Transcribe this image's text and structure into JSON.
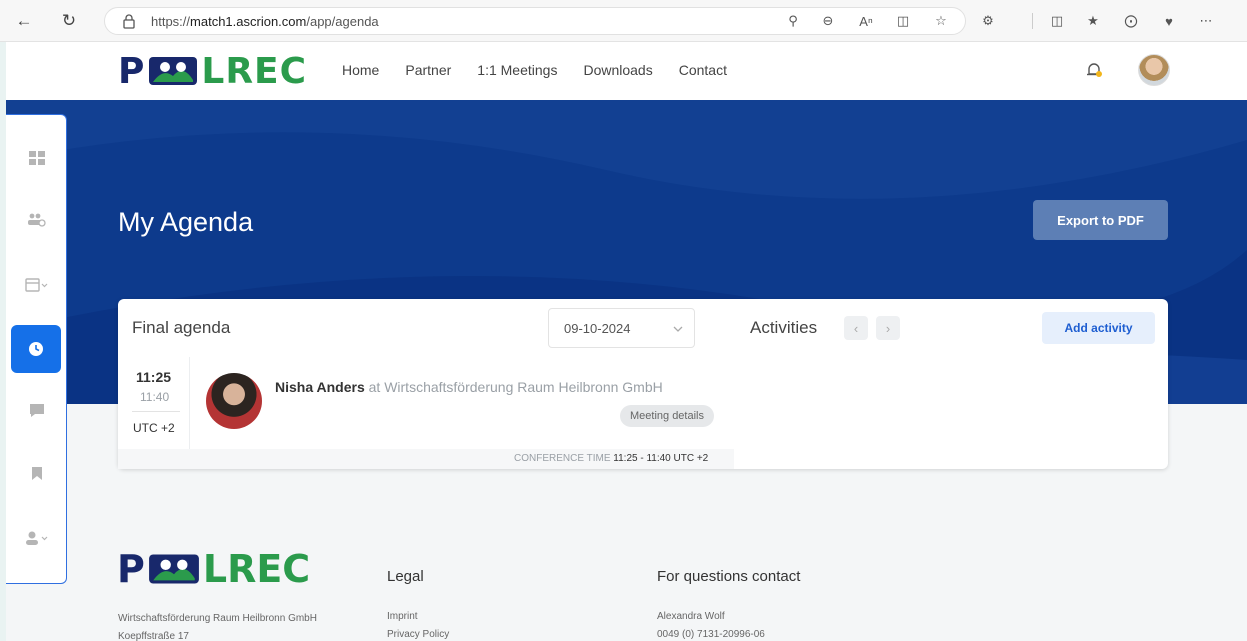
{
  "browser": {
    "url_prefix": "https://",
    "url_host": "match1.ascrion.com",
    "url_path": "/app/agenda"
  },
  "header": {
    "logo_left": "P",
    "logo_right": "LREC",
    "nav": [
      "Home",
      "Partner",
      "1:1 Meetings",
      "Downloads",
      "Contact"
    ]
  },
  "hero": {
    "title": "My Agenda",
    "export_label": "Export to PDF"
  },
  "agenda": {
    "title": "Final agenda",
    "date": "09-10-2024",
    "activities_title": "Activities",
    "add_activity_label": "Add activity",
    "meeting": {
      "start": "11:25",
      "end": "11:40",
      "timezone": "UTC +2",
      "name": "Nisha Anders",
      "org": "at Wirtschaftsförderung Raum Heilbronn GmbH",
      "details_label": "Meeting details",
      "conf_time_label": "CONFERENCE TIME",
      "conf_time_value": "11:25 - 11:40 UTC +2"
    }
  },
  "footer": {
    "logo_left": "P",
    "logo_right": "LREC",
    "company": "Wirtschaftsförderung Raum Heilbronn GmbH",
    "street": "Koepffstraße 17",
    "legal_title": "Legal",
    "legal_links": [
      "Imprint",
      "Privacy Policy"
    ],
    "contact_title": "For questions contact",
    "contact_name": "Alexandra Wolf",
    "contact_phone": "0049 (0) 7131-20996-06"
  },
  "icons": {
    "sidebar": [
      "dashboard-icon",
      "people-search-icon",
      "calendar-icon",
      "clock-icon",
      "chat-icon",
      "bookmark-icon",
      "user-icon"
    ]
  },
  "colors": {
    "hero_bg": "#0d3a8c",
    "accent": "#1570e8",
    "logo_navy": "#18286b",
    "logo_green": "#2b9b4c"
  }
}
